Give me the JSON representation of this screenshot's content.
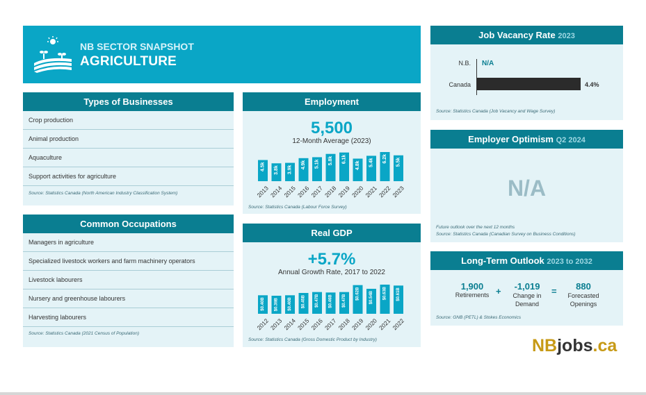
{
  "hero": {
    "kicker": "NB SECTOR SNAPSHOT",
    "title": "AGRICULTURE"
  },
  "types": {
    "title": "Types of Businesses",
    "items": [
      "Crop production",
      "Animal production",
      "Aquaculture",
      "Support activities for agriculture"
    ],
    "source": "Source: Statistics Canada (North American Industry Classification System)"
  },
  "occupations": {
    "title": "Common Occupations",
    "items": [
      "Managers in agriculture",
      "Specialized livestock workers and farm machinery operators",
      "Livestock labourers",
      "Nursery and greenhouse labourers",
      "Harvesting labourers"
    ],
    "source": "Source: Statistics Canada (2021 Census of Population)"
  },
  "employment": {
    "title": "Employment",
    "big": "5,500",
    "sub": "12-Month Average (2023)",
    "source": "Source: Statistics Canada (Labour Force Survey)"
  },
  "gdp": {
    "title": "Real GDP",
    "big": "+5.7%",
    "sub": "Annual Growth Rate, 2017 to 2022",
    "source": "Source: Statistics Canada (Gross Domestic Product by Industry)"
  },
  "vacancy": {
    "title": "Job Vacancy Rate",
    "year": "2023",
    "nb_label": "N.B.",
    "nb_value": "N/A",
    "ca_label": "Canada",
    "ca_value": "4.4%",
    "ca_rate": 4.4,
    "source": "Source: Statistics Canada (Job Vacancy and Wage Survey)"
  },
  "optimism": {
    "title": "Employer Optimism",
    "period": "Q2 2024",
    "value": "N/A",
    "note1": "Future outlook over the next 12 months",
    "note2": "Source: Statistics Canada (Canadian Survey on Business Conditions)"
  },
  "outlook": {
    "title": "Long-Term Outlook",
    "years": "2023 to 2032",
    "ret_value": "1,900",
    "ret_label": "Retirements",
    "plus": "+",
    "dem_value": "-1,019",
    "dem_label1": "Change in",
    "dem_label2": "Demand",
    "eq": "=",
    "open_value": "880",
    "open_label1": "Forecasted",
    "open_label2": "Openings",
    "source": "Source: GNB (PETL) & Stokes Economics"
  },
  "brand": {
    "a": "NB",
    "b": "jobs",
    "c": ".ca"
  },
  "colors": {
    "accent": "#0aa6c6",
    "header": "#0a7e91",
    "panel": "#e4f3f7",
    "bar": "#2b2b2b",
    "gold": "#c79a16"
  },
  "chart_data": [
    {
      "type": "bar",
      "categories": [
        "2013",
        "2014",
        "2015",
        "2016",
        "2017",
        "2018",
        "2019",
        "2020",
        "2021",
        "2022",
        "2023"
      ],
      "values": [
        4.5,
        3.8,
        3.9,
        4.9,
        5.1,
        5.8,
        6.1,
        4.8,
        5.4,
        6.2,
        5.5
      ],
      "labels": [
        "4.5k",
        "3.8k",
        "3.9k",
        "4.9k",
        "5.1k",
        "5.8k",
        "6.1k",
        "4.8k",
        "5.4k",
        "6.2k",
        "5.5k"
      ],
      "grid": false
    },
    {
      "type": "bar",
      "categories": [
        "2012",
        "2013",
        "2014",
        "2015",
        "2016",
        "2017",
        "2018",
        "2019",
        "2020",
        "2021",
        "2022"
      ],
      "values": [
        0.4,
        0.39,
        0.4,
        0.45,
        0.47,
        0.46,
        0.47,
        0.62,
        0.54,
        0.63,
        0.61
      ],
      "labels": [
        "$0.40B",
        "$0.39B",
        "$0.40B",
        "$0.45B",
        "$0.47B",
        "$0.46B",
        "$0.47B",
        "$0.62B",
        "$0.54B",
        "$0.63B",
        "$0.61B"
      ],
      "grid": false
    }
  ]
}
